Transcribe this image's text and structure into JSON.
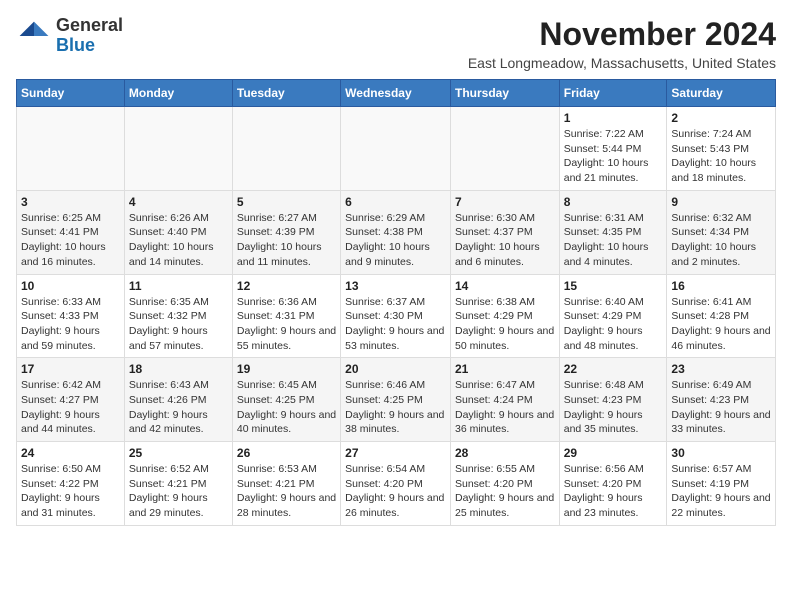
{
  "logo": {
    "general": "General",
    "blue": "Blue"
  },
  "header": {
    "month": "November 2024",
    "location": "East Longmeadow, Massachusetts, United States"
  },
  "weekdays": [
    "Sunday",
    "Monday",
    "Tuesday",
    "Wednesday",
    "Thursday",
    "Friday",
    "Saturday"
  ],
  "weeks": [
    [
      {
        "day": "",
        "info": ""
      },
      {
        "day": "",
        "info": ""
      },
      {
        "day": "",
        "info": ""
      },
      {
        "day": "",
        "info": ""
      },
      {
        "day": "",
        "info": ""
      },
      {
        "day": "1",
        "info": "Sunrise: 7:22 AM\nSunset: 5:44 PM\nDaylight: 10 hours and 21 minutes."
      },
      {
        "day": "2",
        "info": "Sunrise: 7:24 AM\nSunset: 5:43 PM\nDaylight: 10 hours and 18 minutes."
      }
    ],
    [
      {
        "day": "3",
        "info": "Sunrise: 6:25 AM\nSunset: 4:41 PM\nDaylight: 10 hours and 16 minutes."
      },
      {
        "day": "4",
        "info": "Sunrise: 6:26 AM\nSunset: 4:40 PM\nDaylight: 10 hours and 14 minutes."
      },
      {
        "day": "5",
        "info": "Sunrise: 6:27 AM\nSunset: 4:39 PM\nDaylight: 10 hours and 11 minutes."
      },
      {
        "day": "6",
        "info": "Sunrise: 6:29 AM\nSunset: 4:38 PM\nDaylight: 10 hours and 9 minutes."
      },
      {
        "day": "7",
        "info": "Sunrise: 6:30 AM\nSunset: 4:37 PM\nDaylight: 10 hours and 6 minutes."
      },
      {
        "day": "8",
        "info": "Sunrise: 6:31 AM\nSunset: 4:35 PM\nDaylight: 10 hours and 4 minutes."
      },
      {
        "day": "9",
        "info": "Sunrise: 6:32 AM\nSunset: 4:34 PM\nDaylight: 10 hours and 2 minutes."
      }
    ],
    [
      {
        "day": "10",
        "info": "Sunrise: 6:33 AM\nSunset: 4:33 PM\nDaylight: 9 hours and 59 minutes."
      },
      {
        "day": "11",
        "info": "Sunrise: 6:35 AM\nSunset: 4:32 PM\nDaylight: 9 hours and 57 minutes."
      },
      {
        "day": "12",
        "info": "Sunrise: 6:36 AM\nSunset: 4:31 PM\nDaylight: 9 hours and 55 minutes."
      },
      {
        "day": "13",
        "info": "Sunrise: 6:37 AM\nSunset: 4:30 PM\nDaylight: 9 hours and 53 minutes."
      },
      {
        "day": "14",
        "info": "Sunrise: 6:38 AM\nSunset: 4:29 PM\nDaylight: 9 hours and 50 minutes."
      },
      {
        "day": "15",
        "info": "Sunrise: 6:40 AM\nSunset: 4:29 PM\nDaylight: 9 hours and 48 minutes."
      },
      {
        "day": "16",
        "info": "Sunrise: 6:41 AM\nSunset: 4:28 PM\nDaylight: 9 hours and 46 minutes."
      }
    ],
    [
      {
        "day": "17",
        "info": "Sunrise: 6:42 AM\nSunset: 4:27 PM\nDaylight: 9 hours and 44 minutes."
      },
      {
        "day": "18",
        "info": "Sunrise: 6:43 AM\nSunset: 4:26 PM\nDaylight: 9 hours and 42 minutes."
      },
      {
        "day": "19",
        "info": "Sunrise: 6:45 AM\nSunset: 4:25 PM\nDaylight: 9 hours and 40 minutes."
      },
      {
        "day": "20",
        "info": "Sunrise: 6:46 AM\nSunset: 4:25 PM\nDaylight: 9 hours and 38 minutes."
      },
      {
        "day": "21",
        "info": "Sunrise: 6:47 AM\nSunset: 4:24 PM\nDaylight: 9 hours and 36 minutes."
      },
      {
        "day": "22",
        "info": "Sunrise: 6:48 AM\nSunset: 4:23 PM\nDaylight: 9 hours and 35 minutes."
      },
      {
        "day": "23",
        "info": "Sunrise: 6:49 AM\nSunset: 4:23 PM\nDaylight: 9 hours and 33 minutes."
      }
    ],
    [
      {
        "day": "24",
        "info": "Sunrise: 6:50 AM\nSunset: 4:22 PM\nDaylight: 9 hours and 31 minutes."
      },
      {
        "day": "25",
        "info": "Sunrise: 6:52 AM\nSunset: 4:21 PM\nDaylight: 9 hours and 29 minutes."
      },
      {
        "day": "26",
        "info": "Sunrise: 6:53 AM\nSunset: 4:21 PM\nDaylight: 9 hours and 28 minutes."
      },
      {
        "day": "27",
        "info": "Sunrise: 6:54 AM\nSunset: 4:20 PM\nDaylight: 9 hours and 26 minutes."
      },
      {
        "day": "28",
        "info": "Sunrise: 6:55 AM\nSunset: 4:20 PM\nDaylight: 9 hours and 25 minutes."
      },
      {
        "day": "29",
        "info": "Sunrise: 6:56 AM\nSunset: 4:20 PM\nDaylight: 9 hours and 23 minutes."
      },
      {
        "day": "30",
        "info": "Sunrise: 6:57 AM\nSunset: 4:19 PM\nDaylight: 9 hours and 22 minutes."
      }
    ]
  ]
}
